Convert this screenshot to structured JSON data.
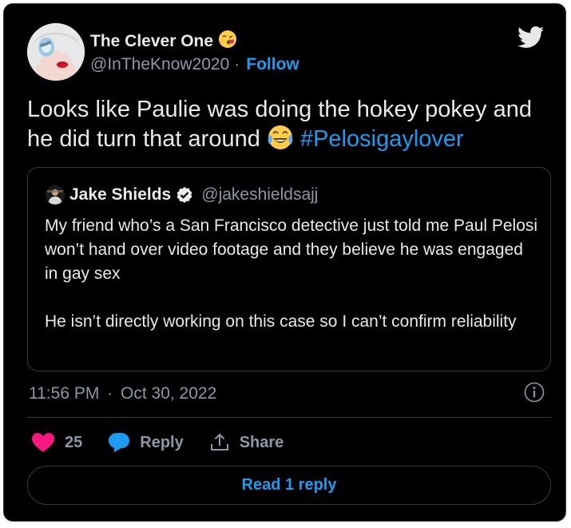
{
  "author": {
    "name": "The Clever One",
    "emoji": "😘",
    "handle": "@InTheKnow2020",
    "separator": "·",
    "follow_label": "Follow"
  },
  "tweet": {
    "text": "Looks like Paulie was doing the hokey pokey and he did turn that around",
    "emoji": "😂",
    "hashtag": "#Pelosigaylover"
  },
  "quoted": {
    "name": "Jake Shields",
    "handle": "@jakeshieldsajj",
    "verified": true,
    "paragraph1": "My friend who’s a San Francisco detective just told me Paul Pelosi won’t hand over video footage and they believe he was engaged in gay sex",
    "paragraph2": "He isn’t directly working on this case  so I can’t confirm reliability"
  },
  "meta": {
    "time": "11:56 PM",
    "separator": "·",
    "date": "Oct 30, 2022"
  },
  "actions": {
    "like_count": "25",
    "reply_label": "Reply",
    "share_label": "Share"
  },
  "read_replies_label": "Read 1 reply",
  "colors": {
    "background": "#000000",
    "text": "#e7e9ea",
    "muted": "#8b98a5",
    "accent": "#1d9bf0",
    "heart": "#f91880",
    "border": "#3a3a3a"
  }
}
